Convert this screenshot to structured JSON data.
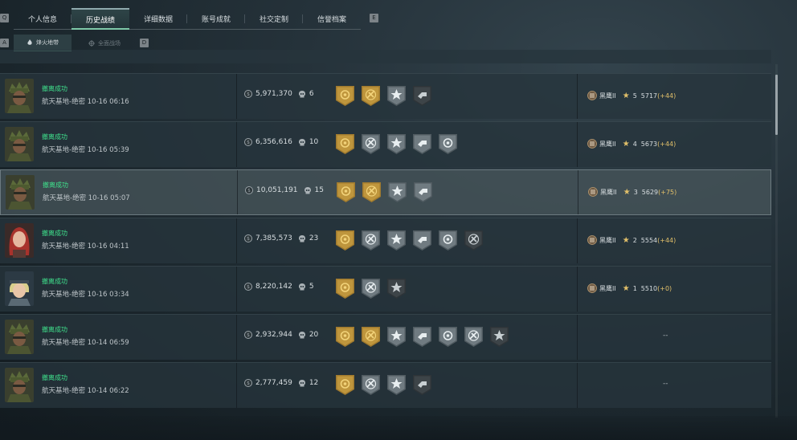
{
  "top_tabs": [
    {
      "label": "个人信息",
      "active": false
    },
    {
      "label": "历史战绩",
      "active": true
    },
    {
      "label": "详细数据",
      "active": false
    },
    {
      "label": "账号成就",
      "active": false
    },
    {
      "label": "社交定制",
      "active": false
    },
    {
      "label": "信誉档案",
      "active": false
    }
  ],
  "keys": {
    "q": "Q",
    "e": "E",
    "a": "A",
    "d": "D"
  },
  "sub_tabs": [
    {
      "label": "烽火地带",
      "active": true
    },
    {
      "label": "全面战场",
      "active": false
    }
  ],
  "colors": {
    "success": "#3fe08c",
    "gold": "#e2c06a",
    "accent": "#7ec8a8"
  },
  "rows": [
    {
      "avatar": "soldier",
      "result": "撤离成功",
      "map_time": "航天基地-绝密 10-16 06:16",
      "money": "5,971,370",
      "kills": "6",
      "badges": [
        "gold",
        "gold",
        "grey",
        "dark"
      ],
      "rank_name": "黑鹰II",
      "stars": "5",
      "score": "5717",
      "delta": "(+44)",
      "highlight": false
    },
    {
      "avatar": "soldier",
      "result": "撤离成功",
      "map_time": "航天基地-绝密 10-16 05:39",
      "money": "6,356,616",
      "kills": "10",
      "badges": [
        "gold",
        "grey",
        "grey",
        "grey",
        "grey"
      ],
      "rank_name": "黑鹰II",
      "stars": "4",
      "score": "5673",
      "delta": "(+44)",
      "highlight": false
    },
    {
      "avatar": "soldier",
      "result": "撤离成功",
      "map_time": "航天基地-绝密 10-16 05:07",
      "money": "10,051,191",
      "kills": "15",
      "badges": [
        "gold",
        "gold",
        "grey",
        "grey"
      ],
      "rank_name": "黑鹰II",
      "stars": "3",
      "score": "5629",
      "delta": "(+75)",
      "highlight": true
    },
    {
      "avatar": "redhair",
      "result": "撤离成功",
      "map_time": "航天基地-绝密 10-16 04:11",
      "money": "7,385,573",
      "kills": "23",
      "badges": [
        "gold",
        "grey",
        "grey",
        "grey",
        "grey",
        "dark"
      ],
      "rank_name": "黑鹰II",
      "stars": "2",
      "score": "5554",
      "delta": "(+44)",
      "highlight": false
    },
    {
      "avatar": "blonde",
      "result": "撤离成功",
      "map_time": "航天基地-绝密 10-16 03:34",
      "money": "8,220,142",
      "kills": "5",
      "badges": [
        "gold",
        "grey",
        "dark"
      ],
      "rank_name": "黑鹰II",
      "stars": "1",
      "score": "5510",
      "delta": "(+0)",
      "highlight": false
    },
    {
      "avatar": "soldier",
      "result": "撤离成功",
      "map_time": "航天基地-绝密 10-14 06:59",
      "money": "2,932,944",
      "kills": "20",
      "badges": [
        "gold",
        "gold",
        "grey",
        "grey",
        "grey",
        "grey",
        "dark"
      ],
      "rank_text": "--",
      "highlight": false
    },
    {
      "avatar": "soldier",
      "result": "撤离成功",
      "map_time": "航天基地-绝密 10-14 06:22",
      "money": "2,777,459",
      "kills": "12",
      "badges": [
        "gold",
        "grey",
        "grey",
        "dark"
      ],
      "rank_text": "--",
      "highlight": false
    }
  ]
}
